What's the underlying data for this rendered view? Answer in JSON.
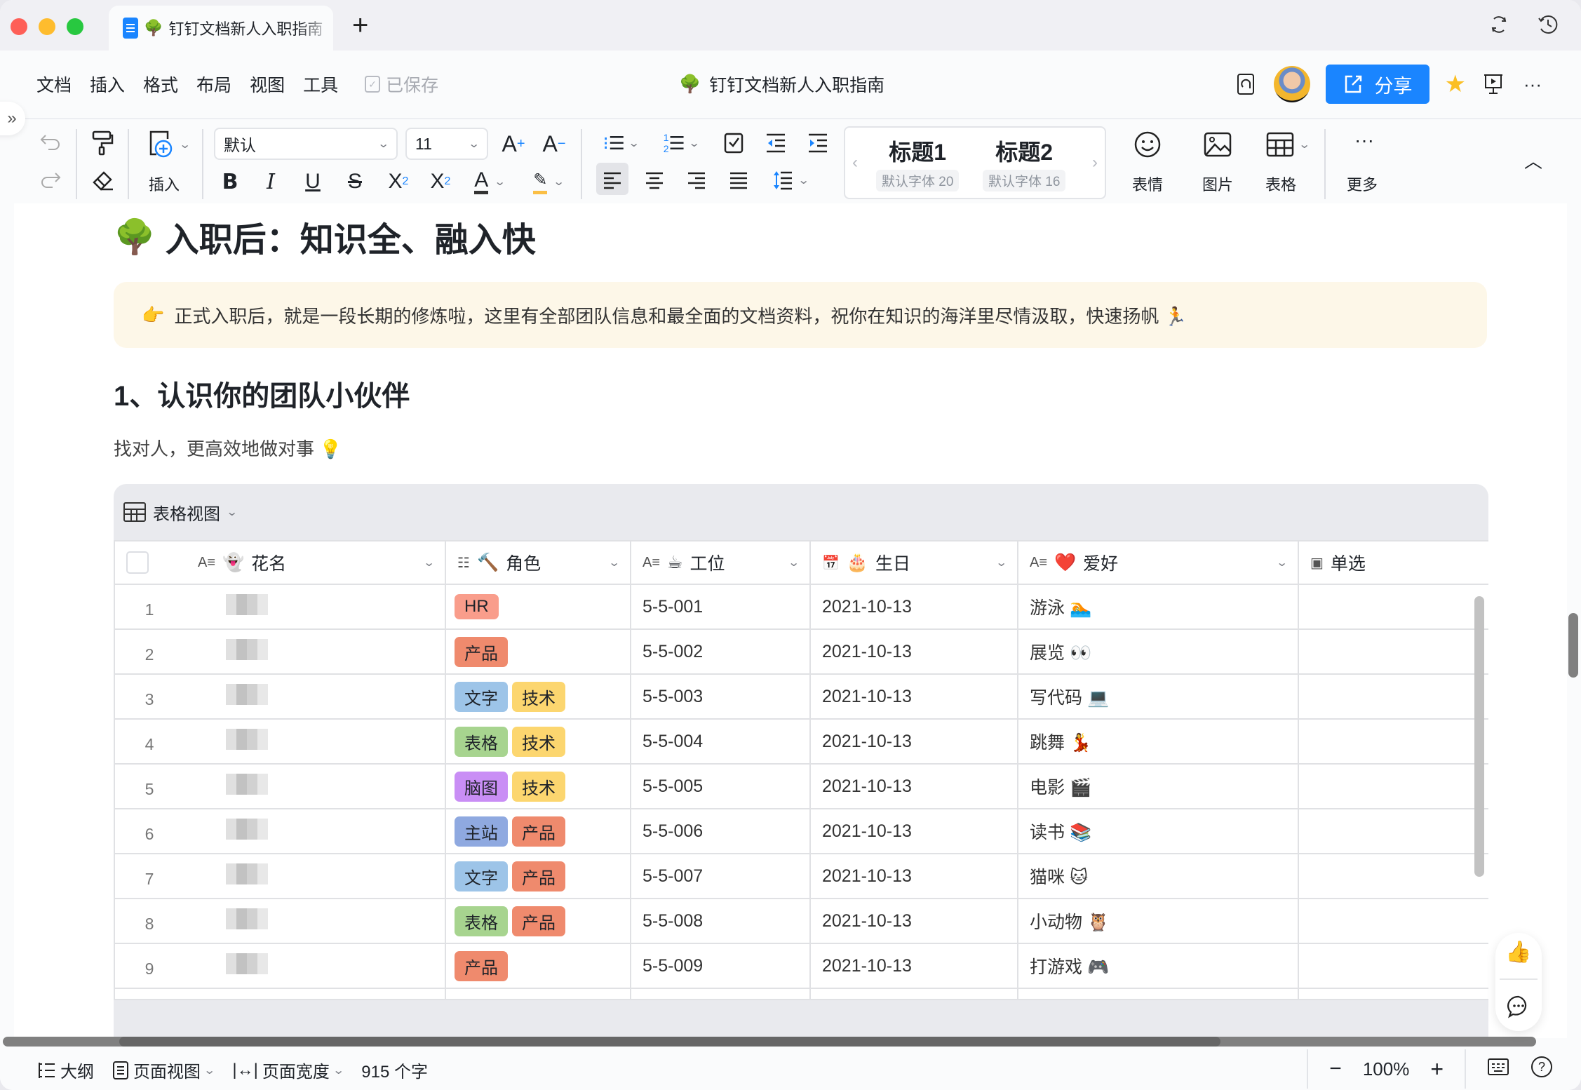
{
  "tab": {
    "title": "钉钉文档新人入职指南",
    "emoji": "🌳",
    "new_tab": "+"
  },
  "menu": {
    "items": [
      "文档",
      "插入",
      "格式",
      "布局",
      "视图",
      "工具"
    ],
    "saved_status": "已保存"
  },
  "doc_title": {
    "emoji": "🌳",
    "text": "钉钉文档新人入职指南"
  },
  "header_right": {
    "share_label": "分享"
  },
  "toolbar": {
    "insert_label": "插入",
    "font_family": "默认",
    "font_size": "11",
    "increase_font": "A",
    "decrease_font": "A",
    "headings": [
      {
        "label": "标题1",
        "sub": "默认字体 20"
      },
      {
        "label": "标题2",
        "sub": "默认字体 16"
      }
    ],
    "emoji_label": "表情",
    "image_label": "图片",
    "table_label": "表格",
    "more_label": "更多",
    "active_alignment": "left"
  },
  "content": {
    "heading1": {
      "emoji": "🌳",
      "text": "入职后：知识全、融入快"
    },
    "callout": {
      "emoji": "👉",
      "text": "正式入职后，就是一段长期的修炼啦，这里有全部团队信息和最全面的文档资料，祝你在知识的海洋里尽情汲取，快速扬帆 🏃"
    },
    "heading2": "1、认识你的团队小伙伴",
    "paragraph": "找对人，更高效地做对事 💡"
  },
  "table": {
    "view_label": "表格视图",
    "columns": [
      {
        "icon": "A≡",
        "emoji": "👻",
        "label": "花名",
        "dropdown": true
      },
      {
        "icon": "☷",
        "emoji": "🔨",
        "label": "角色",
        "dropdown": true
      },
      {
        "icon": "A≡",
        "emoji": "☕",
        "label": "工位",
        "dropdown": true
      },
      {
        "icon": "📅",
        "emoji": "🎂",
        "label": "生日",
        "dropdown": true
      },
      {
        "icon": "A≡",
        "emoji": "❤️",
        "label": "爱好",
        "dropdown": true
      },
      {
        "icon": "▣",
        "emoji": "",
        "label": "单选",
        "dropdown": false
      }
    ],
    "tag_colors": {
      "HR": "#f99d8b",
      "产品": "#ef8a6d",
      "文字": "#9dc4e8",
      "技术": "#fcd66f",
      "表格": "#a7d48f",
      "脑图": "#c98ef5",
      "主站": "#8fa9e0"
    },
    "rows": [
      {
        "num": "1",
        "name": "[blurred]",
        "roles": [
          "HR"
        ],
        "seat": "5-5-001",
        "birthday": "2021-10-13",
        "hobby": "游泳 🏊",
        "single": ""
      },
      {
        "num": "2",
        "name": "[blurred]",
        "roles": [
          "产品"
        ],
        "seat": "5-5-002",
        "birthday": "2021-10-13",
        "hobby": "展览 👀",
        "single": ""
      },
      {
        "num": "3",
        "name": "[blurred]",
        "roles": [
          "文字",
          "技术"
        ],
        "seat": "5-5-003",
        "birthday": "2021-10-13",
        "hobby": "写代码 💻",
        "single": ""
      },
      {
        "num": "4",
        "name": "[blurred]",
        "roles": [
          "表格",
          "技术"
        ],
        "seat": "5-5-004",
        "birthday": "2021-10-13",
        "hobby": "跳舞 💃",
        "single": ""
      },
      {
        "num": "5",
        "name": "[blurred]",
        "roles": [
          "脑图",
          "技术"
        ],
        "seat": "5-5-005",
        "birthday": "2021-10-13",
        "hobby": "电影 🎬",
        "single": ""
      },
      {
        "num": "6",
        "name": "[blurred]",
        "roles": [
          "主站",
          "产品"
        ],
        "seat": "5-5-006",
        "birthday": "2021-10-13",
        "hobby": "读书 📚",
        "single": ""
      },
      {
        "num": "7",
        "name": "[blurred]",
        "roles": [
          "文字",
          "产品"
        ],
        "seat": "5-5-007",
        "birthday": "2021-10-13",
        "hobby": "猫咪 🐱",
        "single": ""
      },
      {
        "num": "8",
        "name": "[blurred]",
        "roles": [
          "表格",
          "产品"
        ],
        "seat": "5-5-008",
        "birthday": "2021-10-13",
        "hobby": "小动物 🦉",
        "single": ""
      },
      {
        "num": "9",
        "name": "[blurred]",
        "roles": [
          "产品"
        ],
        "seat": "5-5-009",
        "birthday": "2021-10-13",
        "hobby": "打游戏 🎮",
        "single": ""
      }
    ]
  },
  "statusbar": {
    "outline": "大纲",
    "page_view": "页面视图",
    "page_width": "页面宽度",
    "word_count": "915 个字",
    "zoom": "100%"
  },
  "colors": {
    "accent": "#1a85ff",
    "callout_bg": "#fdf7e8",
    "star": "#fbbf24"
  }
}
